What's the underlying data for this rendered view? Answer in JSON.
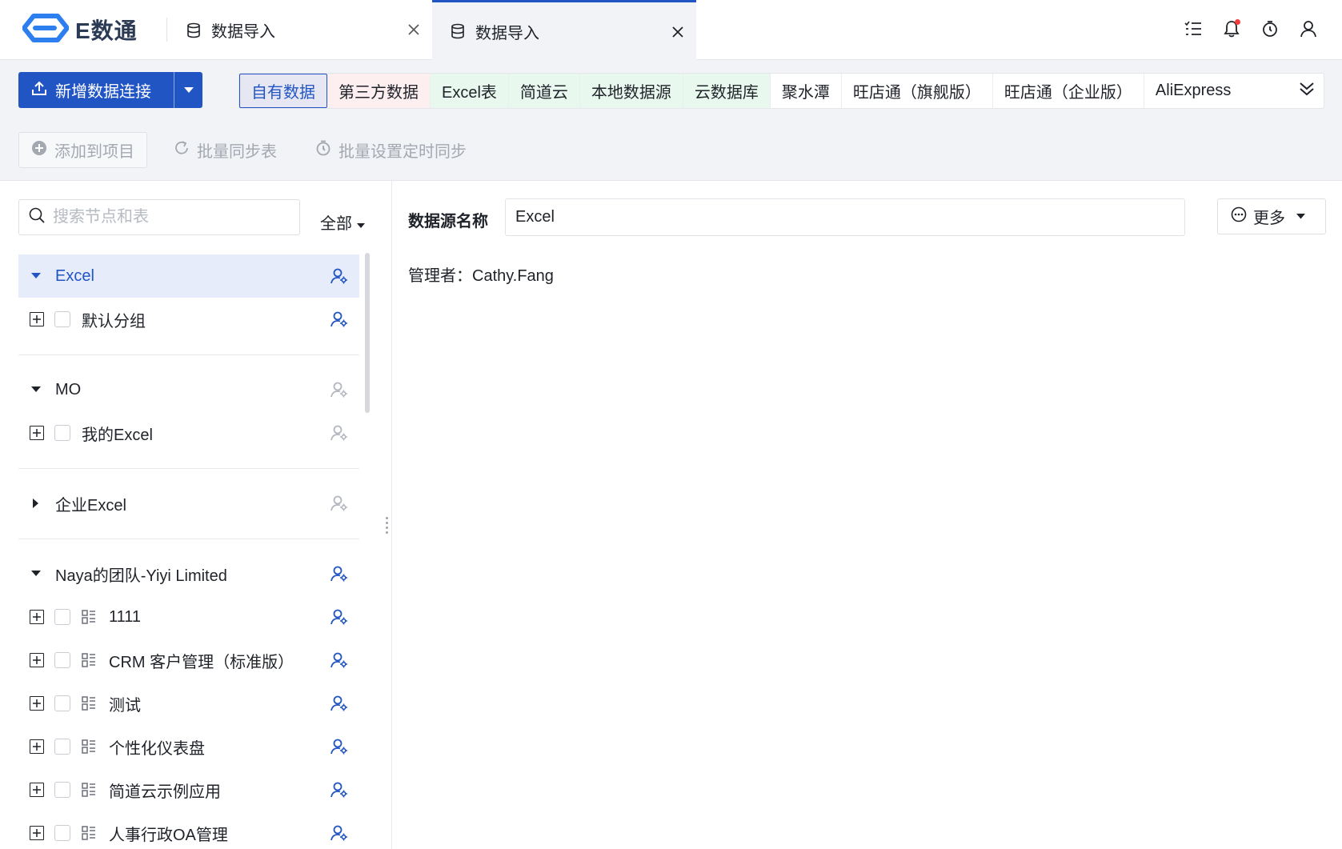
{
  "app": {
    "logo_text": "E数通"
  },
  "tabs": [
    {
      "label": "数据导入"
    },
    {
      "label": "数据导入"
    }
  ],
  "colors": {
    "primary": "#2255c4",
    "notify_dot": "#f23c3c",
    "pink_tab": "#fdeef0",
    "green_tab": "#e9f8ef"
  },
  "toolbar": {
    "new_connection_label": "新增数据连接",
    "source_tabs": [
      "自有数据",
      "第三方数据",
      "Excel表",
      "简道云",
      "本地数据源",
      "云数据库",
      "聚水潭",
      "旺店通（旗舰版）",
      "旺店通（企业版）",
      "AliExpress"
    ],
    "actions": {
      "add_to_project": "添加到项目",
      "batch_sync": "批量同步表",
      "batch_schedule": "批量设置定时同步"
    }
  },
  "sidebar": {
    "search_placeholder": "搜索节点和表",
    "filter_label": "全部",
    "groups": {
      "excel": {
        "label": "Excel",
        "children": [
          "默认分组"
        ]
      },
      "mo": {
        "label": "MO",
        "children": [
          "我的Excel"
        ]
      },
      "enterprise": {
        "label": "企业Excel"
      },
      "naya": {
        "label": "Naya的团队-Yiyi Limited",
        "children": [
          "1111",
          "CRM 客户管理（标准版）",
          "测试",
          "个性化仪表盘",
          "简道云示例应用",
          "人事行政OA管理"
        ]
      }
    }
  },
  "detail": {
    "ds_name_label": "数据源名称",
    "ds_name_value": "Excel",
    "more_label": "更多",
    "manager_text": "管理者：Cathy.Fang"
  }
}
